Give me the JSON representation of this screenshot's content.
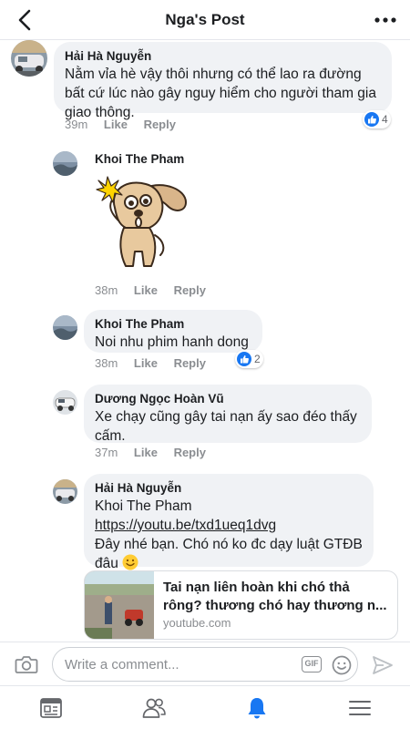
{
  "header": {
    "title": "Nga's Post"
  },
  "comments": [
    {
      "author": "Hải Hà Nguyễn",
      "lines": [
        "Nằm vỉa hè vậy thôi nhưng có thể lao ra đường",
        "bất cứ lúc nào gây nguy hiểm cho người tham gia",
        "giao thông."
      ],
      "time": "39m",
      "like": "Like",
      "reply": "Reply",
      "reactions": "4"
    },
    {
      "author": "Khoi The Pham",
      "sticker": "dog-scared-sticker",
      "time": "38m",
      "like": "Like",
      "reply": "Reply"
    },
    {
      "author": "Khoi The Pham",
      "lines": [
        "Noi nhu phim hanh dong"
      ],
      "time": "38m",
      "like": "Like",
      "reply": "Reply",
      "reactions": "2"
    },
    {
      "author": "Dương Ngọc Hoàn Vũ",
      "lines": [
        "Xe chạy cũng gây tai nạn ấy sao đéo thấy",
        "cấm."
      ],
      "time": "37m",
      "like": "Like",
      "reply": "Reply"
    },
    {
      "author": "Hải Hà Nguyễn",
      "mention": "Khoi The Pham",
      "link": "https://youtu.be/txd1ueq1dvg",
      "lines": [
        "Đây nhé bạn. Chó nó ko đc dạy luật GTĐB",
        "đâu"
      ],
      "preview": {
        "title": "Tai nạn liên hoàn khi chó thả rông? thương chó hay thương n...",
        "domain": "youtube.com"
      }
    }
  ],
  "composer": {
    "placeholder": "Write a comment...",
    "gif_label": "GIF"
  },
  "colors": {
    "accent": "#1877f2",
    "bubble": "#f0f2f5",
    "meta": "#8a8d91"
  },
  "icons": [
    "back-arrow-icon",
    "more-icon",
    "camera-icon",
    "gif-icon",
    "emoji-icon",
    "send-icon",
    "feed-icon",
    "friends-icon",
    "notifications-icon",
    "menu-icon"
  ]
}
